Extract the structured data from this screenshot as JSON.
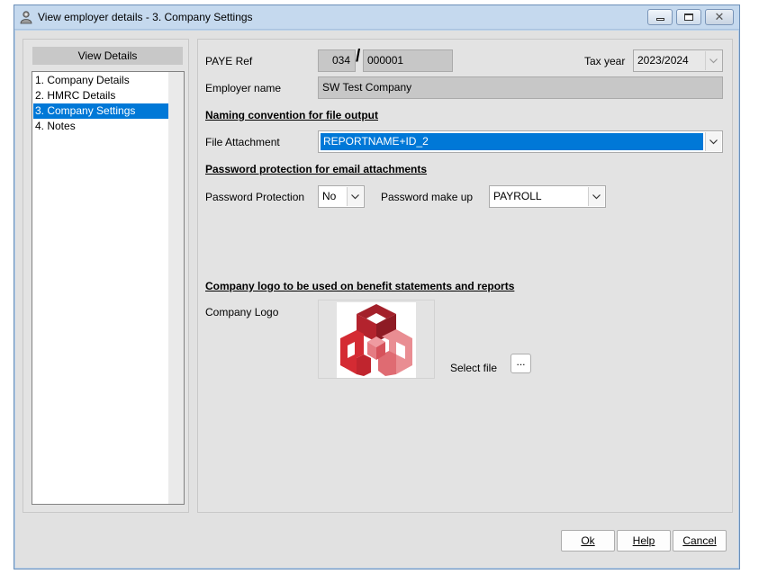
{
  "window": {
    "title": "View employer details - 3. Company Settings"
  },
  "sidebar": {
    "header": "View Details",
    "items": [
      {
        "label": "1. Company Details",
        "selected": false
      },
      {
        "label": "2. HMRC Details",
        "selected": false
      },
      {
        "label": "3. Company Settings",
        "selected": true
      },
      {
        "label": "4. Notes",
        "selected": false
      }
    ]
  },
  "form": {
    "paye_label": "PAYE Ref",
    "paye_office": "034",
    "paye_separator": "/",
    "paye_ref": "000001",
    "tax_year_label": "Tax year",
    "tax_year_value": "2023/2024",
    "employer_name_label": "Employer name",
    "employer_name_value": "SW Test Company",
    "naming_section": "Naming convention for file output",
    "file_attachment_label": "File Attachment",
    "file_attachment_value": "REPORTNAME+ID_2",
    "password_section": "Password protection for email attachments",
    "password_protection_label": "Password Protection",
    "password_protection_value": "No",
    "password_makeup_label": "Password make up",
    "password_makeup_value": "PAYROLL",
    "logo_section": "Company logo to be used on benefit statements and reports",
    "company_logo_label": "Company Logo",
    "select_file_label": "Select file",
    "select_file_button": "..."
  },
  "footer": {
    "ok": "Ok",
    "help": "Help",
    "cancel": "Cancel"
  },
  "colors": {
    "selection": "#0078d7",
    "logo_dark": "#a3202a",
    "logo_mid": "#d42b33",
    "logo_light": "#e98d92"
  }
}
